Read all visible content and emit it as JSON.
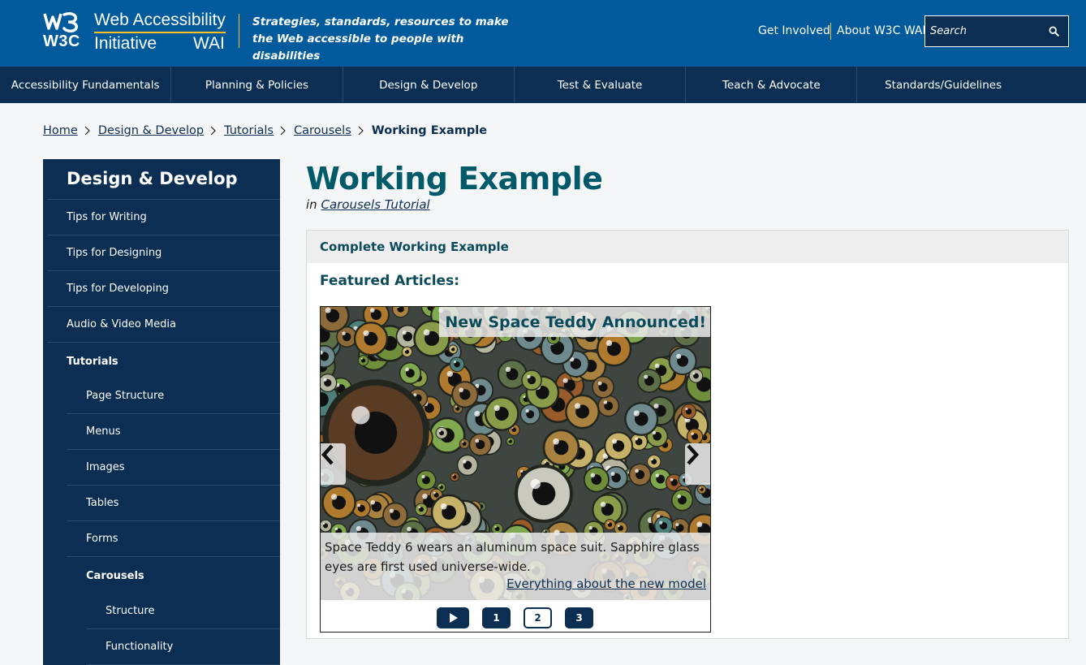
{
  "header": {
    "logo_w3c": "W3C",
    "logo_title": "Web Accessibility",
    "logo_sub": "Initiative",
    "logo_wai": "WAI",
    "tagline": "Strategies, standards, resources to make the Web accessible to people with disabilities",
    "links": [
      "Get Involved",
      "About W3C WAI"
    ],
    "search_placeholder": "Search",
    "search_icon": "search-icon"
  },
  "nav": {
    "items": [
      "Accessibility Fundamentals",
      "Planning & Policies",
      "Design & Develop",
      "Test & Evaluate",
      "Teach & Advocate",
      "Standards/Guidelines"
    ]
  },
  "breadcrumb": {
    "links": [
      "Home",
      "Design & Develop",
      "Tutorials",
      "Carousels"
    ],
    "current": "Working Example"
  },
  "sidebar": {
    "heading": "Design & Develop",
    "items": [
      {
        "label": "Tips for Writing",
        "level": 0,
        "bold": false
      },
      {
        "label": "Tips for Designing",
        "level": 0,
        "bold": false
      },
      {
        "label": "Tips for Developing",
        "level": 0,
        "bold": false
      },
      {
        "label": "Audio & Video Media",
        "level": 0,
        "bold": false
      },
      {
        "label": "Tutorials",
        "level": 0,
        "bold": true
      },
      {
        "label": "Page Structure",
        "level": 1,
        "bold": false
      },
      {
        "label": "Menus",
        "level": 1,
        "bold": false
      },
      {
        "label": "Images",
        "level": 1,
        "bold": false
      },
      {
        "label": "Tables",
        "level": 1,
        "bold": false
      },
      {
        "label": "Forms",
        "level": 1,
        "bold": false
      },
      {
        "label": "Carousels",
        "level": 1,
        "bold": true
      },
      {
        "label": "Structure",
        "level": 2,
        "bold": false
      },
      {
        "label": "Functionality",
        "level": 2,
        "bold": false
      }
    ]
  },
  "main": {
    "title": "Working Example",
    "in_prefix": "in",
    "in_link": "Carousels Tutorial",
    "box_heading": "Complete Working Example",
    "featured": "Featured Articles:"
  },
  "carousel": {
    "slide_title": "New Space Teddy Announced!",
    "caption": "Space Teddy 6 wears an aluminum space suit. Sapphire glass eyes are first used universe-wide.",
    "caption_link": "Everything about the new model",
    "controls": [
      "1",
      "2",
      "3"
    ],
    "selected_slide": "2",
    "play_icon": "play-icon",
    "prev_icon": "chevron-left-icon",
    "next_icon": "chevron-right-icon"
  },
  "colors": {
    "header_bg": "#005a9c",
    "nav_bg": "#0b2e52",
    "accent": "#fcbf21",
    "title": "#005a6a"
  }
}
